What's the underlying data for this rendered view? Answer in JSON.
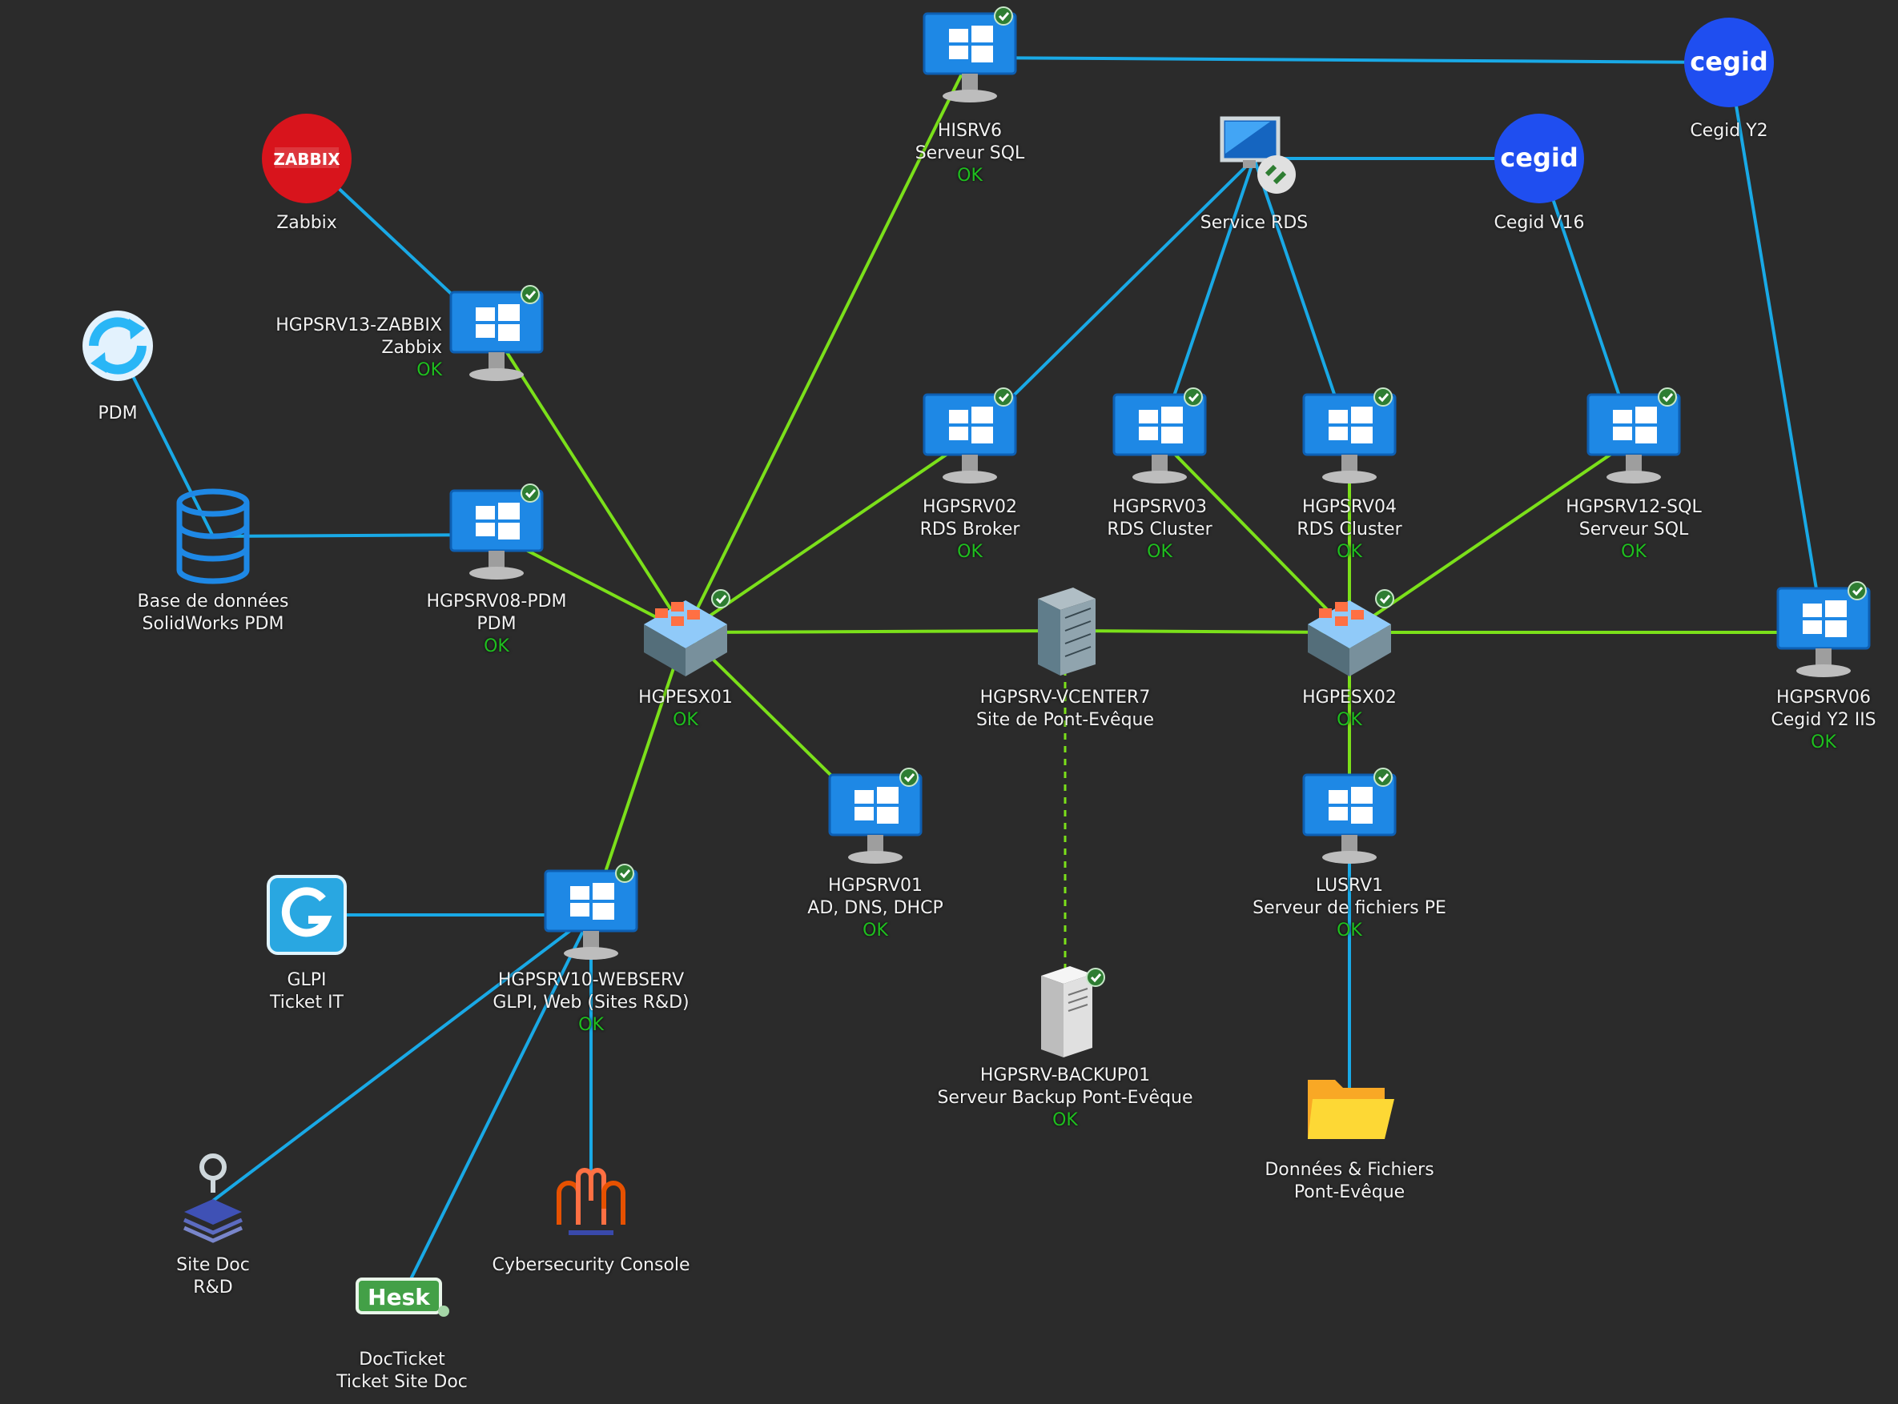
{
  "colors": {
    "background": "#2b2b2b",
    "link_green": "#7be01a",
    "link_blue": "#19a9e6",
    "status_ok": "#1fbf1f",
    "cegid_blue": "#1f4ef0",
    "zabbix_red": "#d8141c",
    "windows_blue": "#1e88e5"
  },
  "nodes": [
    {
      "id": "hisrv6",
      "icon": "windows-monitor-icon",
      "lines": [
        "HISRV6",
        "Serveur SQL"
      ],
      "status": "OK"
    },
    {
      "id": "cegid_y2",
      "icon": "cegid-logo-icon",
      "logo_text": "cegid",
      "lines": [
        "Cegid Y2"
      ],
      "status": ""
    },
    {
      "id": "zabbix",
      "icon": "zabbix-logo-icon",
      "logo_text": "ZABBIX",
      "lines": [
        "Zabbix"
      ],
      "status": ""
    },
    {
      "id": "service_rds",
      "icon": "remote-desktop-icon",
      "lines": [
        "Service RDS"
      ],
      "status": ""
    },
    {
      "id": "cegid_v16",
      "icon": "cegid-logo-icon",
      "logo_text": "cegid",
      "lines": [
        "Cegid V16"
      ],
      "status": ""
    },
    {
      "id": "pdm",
      "icon": "sync-icon",
      "lines": [
        "PDM"
      ],
      "status": ""
    },
    {
      "id": "hgpsrv13",
      "icon": "windows-monitor-icon",
      "lines": [
        "HGPSRV13-ZABBIX",
        "Zabbix"
      ],
      "status": "OK"
    },
    {
      "id": "hgpsrv02",
      "icon": "windows-monitor-icon",
      "lines": [
        "HGPSRV02",
        "RDS Broker"
      ],
      "status": "OK"
    },
    {
      "id": "hgpsrv03",
      "icon": "windows-monitor-icon",
      "lines": [
        "HGPSRV03",
        "RDS Cluster"
      ],
      "status": "OK"
    },
    {
      "id": "hgpsrv04",
      "icon": "windows-monitor-icon",
      "lines": [
        "HGPSRV04",
        "RDS Cluster"
      ],
      "status": "OK"
    },
    {
      "id": "hgpsrv12",
      "icon": "windows-monitor-icon",
      "lines": [
        "HGPSRV12-SQL",
        "Serveur SQL"
      ],
      "status": "OK"
    },
    {
      "id": "solidworks_db",
      "icon": "database-icon",
      "lines": [
        "Base de données",
        "SolidWorks PDM"
      ],
      "status": ""
    },
    {
      "id": "hgpsrv08",
      "icon": "windows-monitor-icon",
      "lines": [
        "HGPSRV08-PDM",
        "PDM"
      ],
      "status": "OK"
    },
    {
      "id": "hgpesx01",
      "icon": "esx-host-icon",
      "lines": [
        "HGPESX01"
      ],
      "status": "OK"
    },
    {
      "id": "vcenter",
      "icon": "server-rack-icon",
      "lines": [
        "HGPSRV-VCENTER7",
        "Site de Pont-Evêque"
      ],
      "status": ""
    },
    {
      "id": "hgpesx02",
      "icon": "esx-host-icon",
      "lines": [
        "HGPESX02"
      ],
      "status": "OK"
    },
    {
      "id": "hgpsrv06",
      "icon": "windows-monitor-icon",
      "lines": [
        "HGPSRV06",
        "Cegid Y2 IIS"
      ],
      "status": "OK"
    },
    {
      "id": "hgpsrv01",
      "icon": "windows-monitor-icon",
      "lines": [
        "HGPSRV01",
        "AD, DNS, DHCP"
      ],
      "status": "OK"
    },
    {
      "id": "lusrv1",
      "icon": "windows-monitor-icon",
      "lines": [
        "LUSRV1",
        "Serveur de fichiers PE"
      ],
      "status": "OK"
    },
    {
      "id": "glpi",
      "icon": "glpi-logo-icon",
      "lines": [
        "GLPI",
        "Ticket IT"
      ],
      "status": ""
    },
    {
      "id": "hgpsrv10",
      "icon": "windows-monitor-icon",
      "lines": [
        "HGPSRV10-WEBSERV",
        "GLPI, Web (Sites R&D)"
      ],
      "status": "OK"
    },
    {
      "id": "backup01",
      "icon": "tower-server-icon",
      "lines": [
        "HGPSRV-BACKUP01",
        "Serveur Backup Pont-Evêque"
      ],
      "status": "OK"
    },
    {
      "id": "donnees",
      "icon": "folder-icon",
      "lines": [
        "Données & Fichiers",
        "Pont-Evêque"
      ],
      "status": ""
    },
    {
      "id": "site_doc",
      "icon": "doc-stack-icon",
      "lines": [
        "Site Doc",
        "R&D"
      ],
      "status": ""
    },
    {
      "id": "cyber",
      "icon": "cybersecurity-icon",
      "lines": [
        "Cybersecurity Console"
      ],
      "status": ""
    },
    {
      "id": "docticket",
      "icon": "hesk-logo-icon",
      "logo_text": "Hesk",
      "lines": [
        "DocTicket",
        "Ticket Site Doc"
      ],
      "status": ""
    }
  ],
  "links": [
    {
      "from": "hisrv6",
      "to": "cegid_y2",
      "color": "blue"
    },
    {
      "from": "hisrv6",
      "to": "hgpesx01",
      "color": "green"
    },
    {
      "from": "zabbix",
      "to": "hgpsrv13",
      "color": "blue"
    },
    {
      "from": "hgpsrv13",
      "to": "hgpesx01",
      "color": "green"
    },
    {
      "from": "pdm",
      "to": "solidworks_db",
      "color": "blue"
    },
    {
      "from": "solidworks_db",
      "to": "hgpsrv08",
      "color": "blue"
    },
    {
      "from": "hgpsrv08",
      "to": "hgpesx01",
      "color": "green"
    },
    {
      "from": "service_rds",
      "to": "cegid_v16",
      "color": "blue"
    },
    {
      "from": "service_rds",
      "to": "hgpsrv02",
      "color": "blue"
    },
    {
      "from": "service_rds",
      "to": "hgpsrv03",
      "color": "blue"
    },
    {
      "from": "service_rds",
      "to": "hgpsrv04",
      "color": "blue"
    },
    {
      "from": "cegid_v16",
      "to": "hgpsrv12",
      "color": "blue"
    },
    {
      "from": "cegid_y2",
      "to": "hgpsrv06",
      "color": "blue"
    },
    {
      "from": "hgpsrv02",
      "to": "hgpesx01",
      "color": "green"
    },
    {
      "from": "hgpsrv03",
      "to": "hgpesx02",
      "color": "green"
    },
    {
      "from": "hgpsrv04",
      "to": "hgpesx02",
      "color": "green"
    },
    {
      "from": "hgpsrv12",
      "to": "hgpesx02",
      "color": "green"
    },
    {
      "from": "hgpesx01",
      "to": "vcenter",
      "color": "green"
    },
    {
      "from": "vcenter",
      "to": "hgpesx02",
      "color": "green"
    },
    {
      "from": "hgpesx02",
      "to": "hgpsrv06",
      "color": "green"
    },
    {
      "from": "hgpesx01",
      "to": "hgpsrv01",
      "color": "green"
    },
    {
      "from": "hgpesx01",
      "to": "hgpsrv10",
      "color": "green"
    },
    {
      "from": "hgpesx02",
      "to": "lusrv1",
      "color": "green"
    },
    {
      "from": "vcenter",
      "to": "backup01",
      "color": "green",
      "dashed": true
    },
    {
      "from": "lusrv1",
      "to": "donnees",
      "color": "blue"
    },
    {
      "from": "glpi",
      "to": "hgpsrv10",
      "color": "blue"
    },
    {
      "from": "hgpsrv10",
      "to": "site_doc",
      "color": "blue"
    },
    {
      "from": "hgpsrv10",
      "to": "docticket",
      "color": "blue"
    },
    {
      "from": "hgpsrv10",
      "to": "cyber",
      "color": "blue"
    }
  ]
}
